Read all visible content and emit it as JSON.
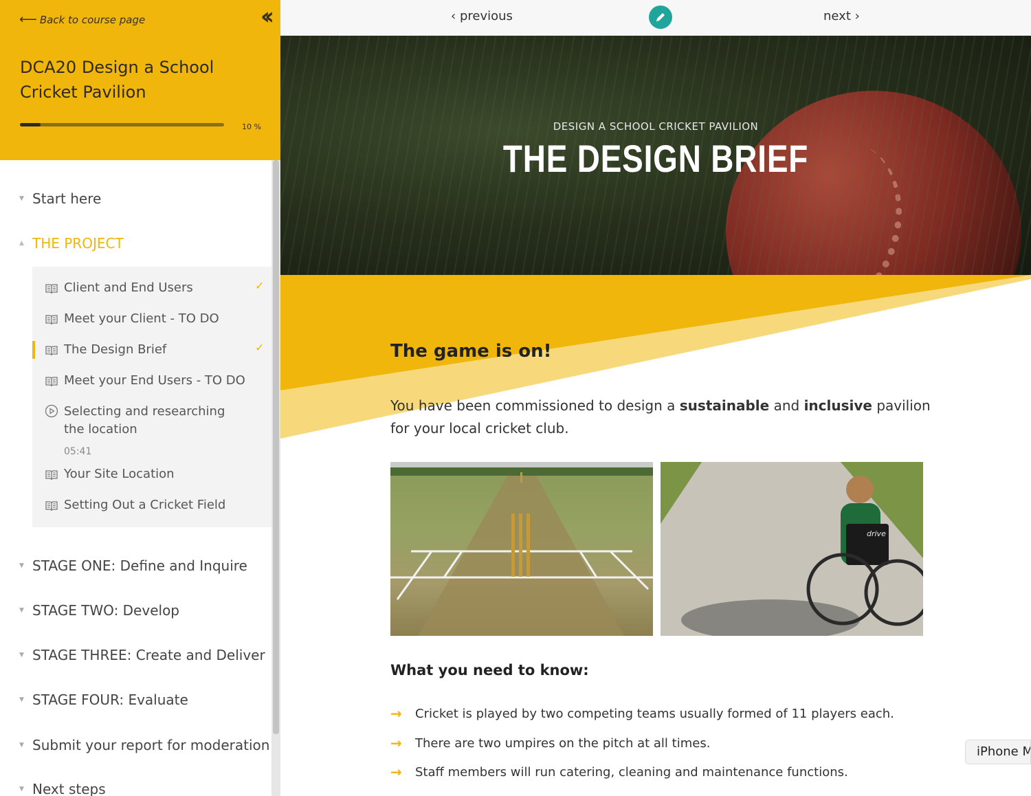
{
  "sidebar": {
    "back_label": "Back to course page",
    "course_title": "DCA20 Design a School Cricket Pavilion",
    "progress": {
      "percent": 10,
      "label": "10 %"
    },
    "sections": [
      {
        "label": "Start here"
      },
      {
        "label": "THE PROJECT",
        "active": true
      },
      {
        "label": "STAGE ONE: Define and Inquire"
      },
      {
        "label": "STAGE TWO: Develop"
      },
      {
        "label": "STAGE THREE: Create and Deliver"
      },
      {
        "label": "STAGE FOUR: Evaluate"
      },
      {
        "label": "Submit your report for moderation"
      },
      {
        "label": "Next steps"
      }
    ],
    "lessons": [
      {
        "label": "Client and End Users",
        "icon": "book-icon",
        "complete": true
      },
      {
        "label": "Meet your Client - TO DO",
        "icon": "book-icon",
        "complete": false
      },
      {
        "label": "The Design Brief",
        "icon": "book-icon",
        "complete": true,
        "current": true
      },
      {
        "label": "Meet your End Users - TO DO",
        "icon": "book-icon",
        "complete": false
      },
      {
        "label": "Selecting and researching the location",
        "icon": "play-circle-icon",
        "duration": "05:41",
        "complete": false
      },
      {
        "label": "Your Site Location",
        "icon": "book-icon",
        "complete": false
      },
      {
        "label": "Setting Out a Cricket Field",
        "icon": "book-icon",
        "complete": false
      }
    ]
  },
  "nav": {
    "previous_label": "previous",
    "next_label": "next"
  },
  "hero": {
    "overline": "DESIGN A SCHOOL CRICKET PAVILION",
    "title": "THE DESIGN BRIEF"
  },
  "content": {
    "heading": "The game is on!",
    "intro": {
      "part1": "You have been commissioned to design a ",
      "bold1": "sustainable",
      "part2": " and ",
      "bold2": "inclusive",
      "part3": " pavilion for your local cricket club."
    },
    "photo_wheelchair_brand": "drive",
    "subheading": "What you need to know:",
    "bullets": [
      "Cricket is played by two competing teams usually formed of 11 players each.",
      "There are two umpires on the pitch at all times.",
      "Staff members will run catering, cleaning and maintenance functions."
    ]
  },
  "device_tag": "iPhone M",
  "colors": {
    "accent": "#f0b60b",
    "accent_light": "#f7d87a",
    "edit_button": "#1fa59c"
  }
}
